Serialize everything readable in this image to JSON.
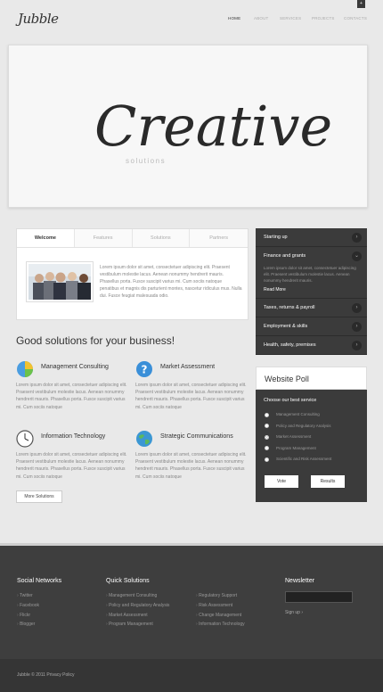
{
  "header": {
    "logo": "Jubble",
    "nav": [
      "HOME",
      "ABOUT",
      "SERVICES",
      "PROJECTS",
      "CONTACTS"
    ],
    "corner_button": "+"
  },
  "hero": {
    "title": "Creative",
    "subtitle": "solutions"
  },
  "tabs": {
    "labels": [
      "Welcome",
      "Features",
      "Solutions",
      "Partners"
    ],
    "text": "Lorem ipsum dolor sit amet, consectetuer adipiscing elit. Praesent vestibulum molestie lacus. Aenean nonummy hendrerit mauris. Phasellus porta. Fusce suscipit varius mi. Cum sociis natoque penatibus et magnis dis parturient montes, nascetur ridiculus mus. Nulla dui. Fusce feugiat malesuada odio."
  },
  "section": {
    "title": "Good solutions for your business!",
    "more_button": "More Solutions"
  },
  "services": [
    {
      "title": "Management Consulting",
      "icon": "pie-chart-icon",
      "text": "Lorem ipsum dolor sit amet, consectetuer adipiscing elit. Praesent vestibulum molestie lacus. Aenean nonummy hendrerit mauris. Phasellus porta. Fusce suscipit varius mi. Cum sociis natoque"
    },
    {
      "title": "Market Assessment",
      "icon": "help-icon",
      "text": "Lorem ipsum dolor sit amet, consectetuer adipiscing elit. Praesent vestibulum molestie lacus. Aenean nonummy hendrerit mauris. Phasellus porta. Fusce suscipit varius mi. Cum sociis natoque"
    },
    {
      "title": "Information Technology",
      "icon": "clock-icon",
      "text": "Lorem ipsum dolor sit amet, consectetuer adipiscing elit. Praesent vestibulum molestie lacus. Aenean nonummy hendrerit mauris. Phasellus porta. Fusce suscipit varius mi. Cum sociis natoque"
    },
    {
      "title": "Strategic Communications",
      "icon": "globe-icon",
      "text": "Lorem ipsum dolor sit amet, consectetuer adipiscing elit. Praesent vestibulum molestie lacus. Aenean nonummy hendrerit mauris. Phasellus porta. Fusce suscipit varius mi. Cum sociis natoque"
    }
  ],
  "accordion": {
    "items": [
      "Starting up",
      "Finance and grants",
      "Taxes, returns & payroll",
      "Employment & skills",
      "Health, safety, premises"
    ],
    "open_text": "Lorem ipsum dolor sit amet, consectetuer adipiscing elit. Praesent vestibulum molestie lacus. Aenean nonummy hendrerit mauris.",
    "read_more": "Read More"
  },
  "poll": {
    "title": "Website Poll",
    "question": "Choose our best service",
    "options": [
      "Management Consulting",
      "Policy and Regulatory Analysis",
      "Market Assessment",
      "Program Management",
      "Scientific and Risk Assessment"
    ],
    "selected": 2,
    "vote": "Vote",
    "results": "Results"
  },
  "footer": {
    "social": {
      "title": "Social Networks",
      "links": [
        "Twitter",
        "Facebook",
        "Flickr",
        "Blogger"
      ]
    },
    "quick": {
      "title": "Quick Solutions",
      "col1": [
        "Management Consulting",
        "Policy and Regulatory Analysis",
        "Market Assessment",
        "Program Management"
      ],
      "col2": [
        "Regulatory Support",
        "Risk Assessment",
        "Change Management",
        "Information Technology"
      ]
    },
    "newsletter": {
      "title": "Newsletter",
      "signup": "Sign up ›"
    },
    "copyright": "Jubble © 2011 Privacy Policy"
  }
}
